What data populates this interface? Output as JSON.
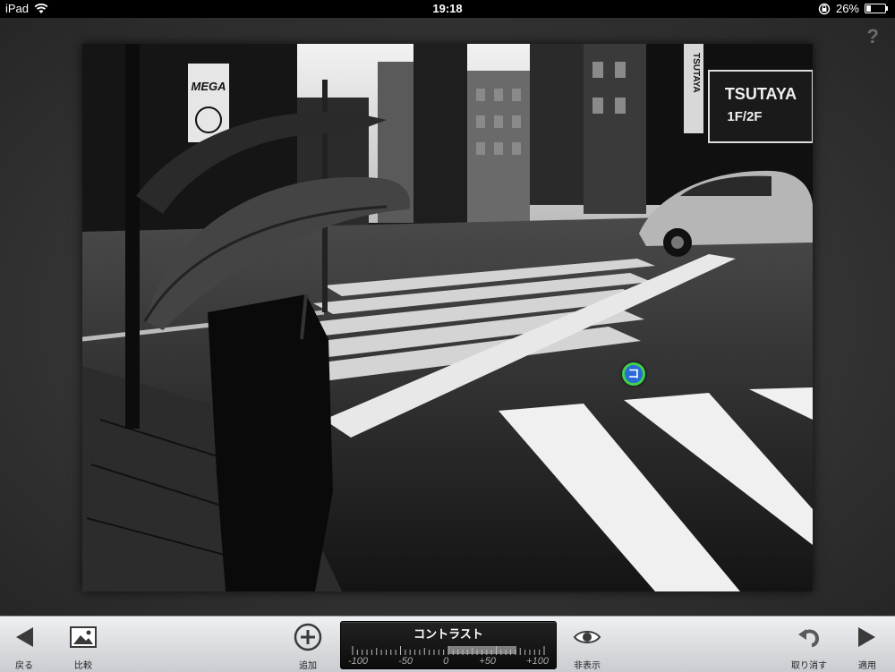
{
  "status": {
    "device": "iPad",
    "time": "19:18",
    "battery": "26%",
    "battery_level": 0.26
  },
  "help_label": "?",
  "control_point_label": "コ",
  "toolbar": {
    "back_label": "戻る",
    "compare_label": "比較",
    "add_label": "追加",
    "hide_label": "非表示",
    "undo_label": "取り消す",
    "apply_label": "適用"
  },
  "slider": {
    "title": "コントラスト",
    "scale": [
      "-100",
      "-50",
      "0",
      "+50",
      "+100"
    ],
    "value_fraction": 0.85
  },
  "colors": {
    "toolbar_bg": "#e2e4e7",
    "slider_bg": "#111111",
    "control_ring": "#3fd24a",
    "control_fill": "#2a6ad8"
  },
  "photo_signs": {
    "mega": "MEGA",
    "tsutaya": "TSUTAYA",
    "floors": "1F/2F",
    "tsutaya_vertical": "TSUTAYA"
  }
}
